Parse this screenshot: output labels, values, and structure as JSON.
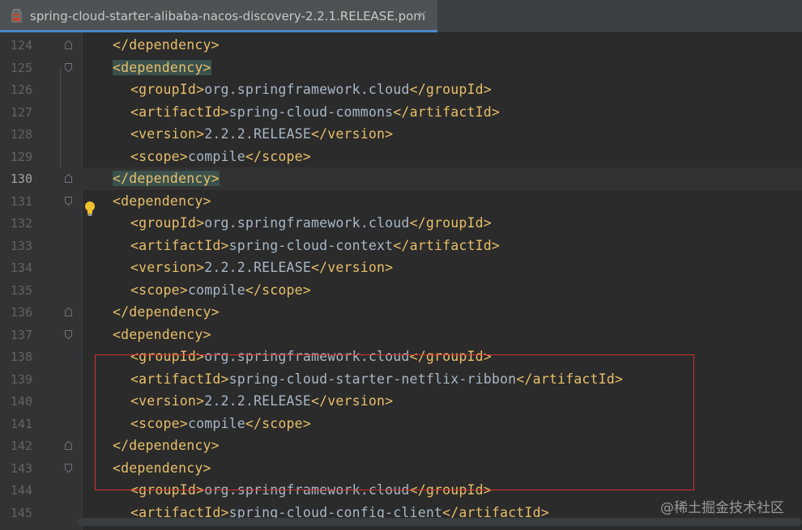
{
  "tab": {
    "title": "spring-cloud-starter-alibaba-nacos-discovery-2.2.1.RELEASE.pom",
    "close": "×",
    "icon": "maven-pom-file-icon"
  },
  "editor": {
    "current_line": 130,
    "lines": [
      {
        "n": "124",
        "segs": [
          {
            "t": "</dependency>",
            "c": "tag"
          }
        ]
      },
      {
        "n": "125",
        "segs": [
          {
            "t": "<dependency>",
            "c": "tag hl"
          }
        ]
      },
      {
        "n": "126",
        "segs": [
          {
            "t": "<groupId>",
            "c": "tag"
          },
          {
            "t": "org.springframework.cloud",
            "c": "txt"
          },
          {
            "t": "</groupId>",
            "c": "tag"
          }
        ]
      },
      {
        "n": "127",
        "segs": [
          {
            "t": "<artifactId>",
            "c": "tag"
          },
          {
            "t": "spring-cloud-commons",
            "c": "txt"
          },
          {
            "t": "</artifactId>",
            "c": "tag"
          }
        ]
      },
      {
        "n": "128",
        "segs": [
          {
            "t": "<version>",
            "c": "tag"
          },
          {
            "t": "2.2.2.RELEASE",
            "c": "txt"
          },
          {
            "t": "</version>",
            "c": "tag"
          }
        ]
      },
      {
        "n": "129",
        "segs": [
          {
            "t": "<scope>",
            "c": "tag"
          },
          {
            "t": "compile",
            "c": "txt"
          },
          {
            "t": "</scope>",
            "c": "tag"
          }
        ]
      },
      {
        "n": "130",
        "segs": [
          {
            "t": "</dependency>",
            "c": "tag hl"
          }
        ]
      },
      {
        "n": "131",
        "segs": [
          {
            "t": "<dependency>",
            "c": "tag"
          }
        ]
      },
      {
        "n": "132",
        "segs": [
          {
            "t": "<groupId>",
            "c": "tag"
          },
          {
            "t": "org.springframework.cloud",
            "c": "txt"
          },
          {
            "t": "</groupId>",
            "c": "tag"
          }
        ]
      },
      {
        "n": "133",
        "segs": [
          {
            "t": "<artifactId>",
            "c": "tag"
          },
          {
            "t": "spring-cloud-context",
            "c": "txt"
          },
          {
            "t": "</artifactId>",
            "c": "tag"
          }
        ]
      },
      {
        "n": "134",
        "segs": [
          {
            "t": "<version>",
            "c": "tag"
          },
          {
            "t": "2.2.2.RELEASE",
            "c": "txt"
          },
          {
            "t": "</version>",
            "c": "tag"
          }
        ]
      },
      {
        "n": "135",
        "segs": [
          {
            "t": "<scope>",
            "c": "tag"
          },
          {
            "t": "compile",
            "c": "txt"
          },
          {
            "t": "</scope>",
            "c": "tag"
          }
        ]
      },
      {
        "n": "136",
        "segs": [
          {
            "t": "</dependency>",
            "c": "tag"
          }
        ]
      },
      {
        "n": "137",
        "segs": [
          {
            "t": "<dependency>",
            "c": "tag"
          }
        ]
      },
      {
        "n": "138",
        "segs": [
          {
            "t": "<groupId>",
            "c": "tag"
          },
          {
            "t": "org.springframework.cloud",
            "c": "txt"
          },
          {
            "t": "</groupId>",
            "c": "tag"
          }
        ]
      },
      {
        "n": "139",
        "segs": [
          {
            "t": "<artifactId>",
            "c": "tag"
          },
          {
            "t": "spring-cloud-starter-netflix-ribbon",
            "c": "txt"
          },
          {
            "t": "</artifactId>",
            "c": "tag"
          }
        ]
      },
      {
        "n": "140",
        "segs": [
          {
            "t": "<version>",
            "c": "tag"
          },
          {
            "t": "2.2.2.RELEASE",
            "c": "txt"
          },
          {
            "t": "</version>",
            "c": "tag"
          }
        ]
      },
      {
        "n": "141",
        "segs": [
          {
            "t": "<scope>",
            "c": "tag"
          },
          {
            "t": "compile",
            "c": "txt"
          },
          {
            "t": "</scope>",
            "c": "tag"
          }
        ]
      },
      {
        "n": "142",
        "segs": [
          {
            "t": "</dependency>",
            "c": "tag"
          }
        ]
      },
      {
        "n": "143",
        "segs": [
          {
            "t": "<dependency>",
            "c": "tag"
          }
        ]
      },
      {
        "n": "144",
        "segs": [
          {
            "t": "<groupId>",
            "c": "tag"
          },
          {
            "t": "org.springframework.cloud",
            "c": "txt"
          },
          {
            "t": "</groupId>",
            "c": "tag"
          }
        ]
      },
      {
        "n": "145",
        "segs": [
          {
            "t": "<artifactId>",
            "c": "tag"
          },
          {
            "t": "spring-cloud-config-client",
            "c": "txt"
          },
          {
            "t": "</artifactId>",
            "c": "tag"
          }
        ]
      }
    ]
  },
  "watermark": "@稀土掘金技术社区",
  "colors": {
    "background": "#2b2b2b",
    "tag": "#e8bf6a",
    "text": "#a9b7c6",
    "highlight": "#3b514d",
    "annotation_box": "#d9302c"
  }
}
